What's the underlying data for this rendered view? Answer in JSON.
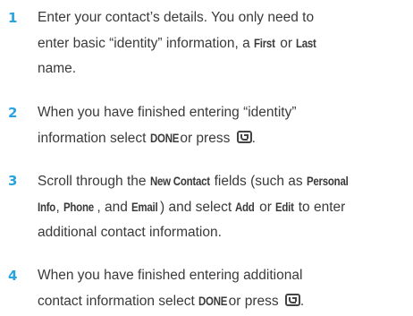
{
  "steps": [
    {
      "number": "1",
      "line1": "Enter your contact’s details. You only need to",
      "line2_a": "enter basic “identity” information, a ",
      "first": "First",
      "or": " or ",
      "last": "Last",
      "line3": "name."
    },
    {
      "number": "2",
      "line1": "When you have finished entering “identity”",
      "line2_a": "information select ",
      "done": "DONE",
      "line2_b": " or press ",
      "key_icon": "soft-key-icon",
      "line2_c": "."
    },
    {
      "number": "3",
      "line1_a": "Scroll through the ",
      "new_contact": "New Contact",
      "line1_b": " fields (such as ",
      "personal": "Personal",
      "info": "Info",
      "line2_a": ", ",
      "phone": "Phone",
      "line2_b": ", and ",
      "email": "Email",
      "line2_c": ") and select ",
      "add": "Add",
      "or": " or ",
      "edit": "Edit",
      "line2_d": " to enter",
      "line3": "additional contact information."
    },
    {
      "number": "4",
      "line1": "When you have finished entering additional",
      "line2_a": "contact information select ",
      "done": "DONE",
      "line2_b": " or press ",
      "key_icon": "soft-key-icon",
      "line2_c": "."
    }
  ]
}
